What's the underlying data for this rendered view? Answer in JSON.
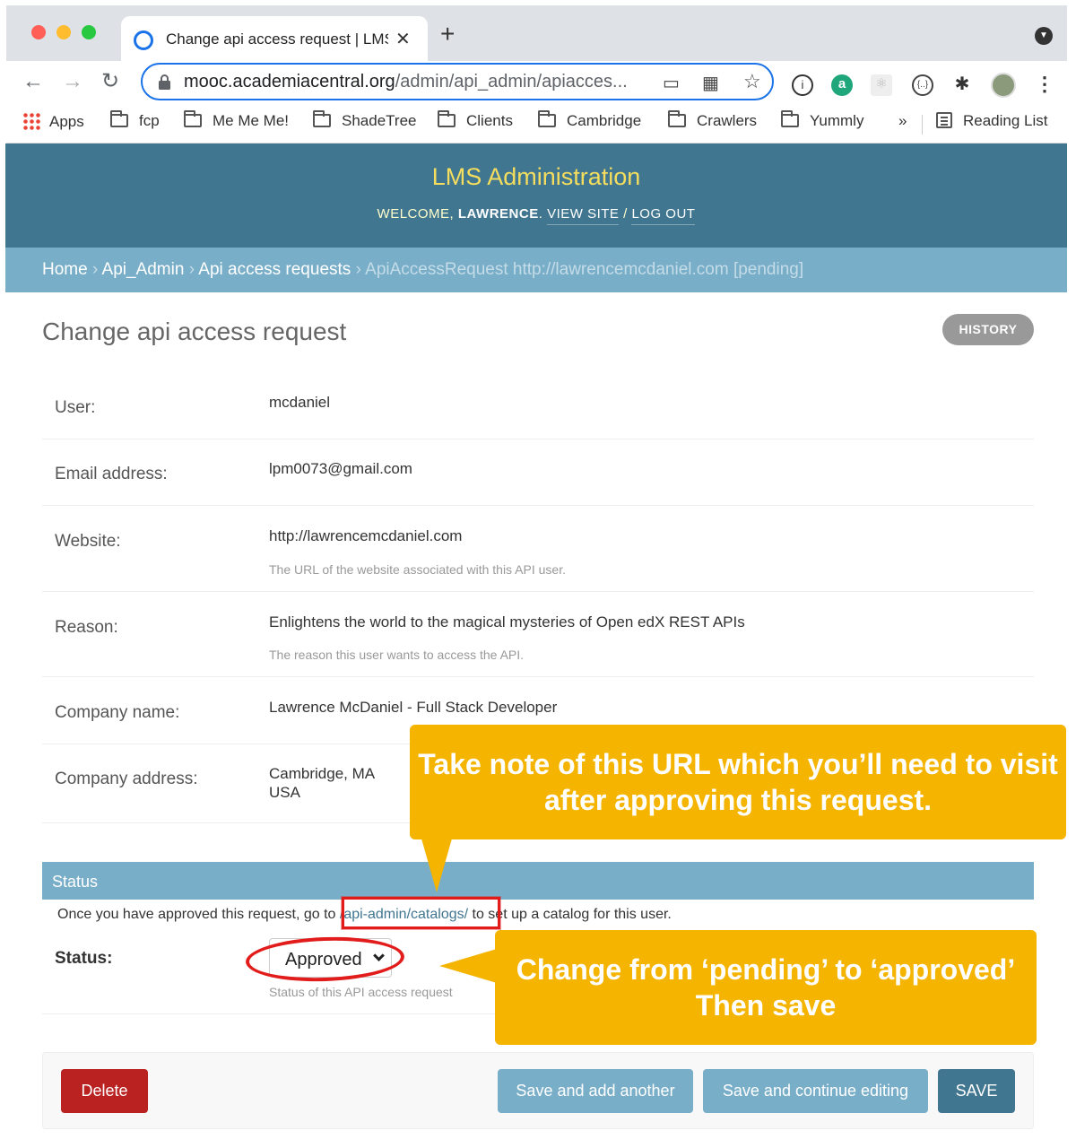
{
  "browser": {
    "tab_title": "Change api access request | LMS",
    "tab_close": "✕",
    "new_tab": "+",
    "nav": {
      "back": "←",
      "forward": "→",
      "reload": "↻"
    },
    "url_host": "mooc.academiacentral.org",
    "url_path": "/admin/api_admin/apiacces...",
    "omnibox_icons": {
      "cast": "▭",
      "qr": "▦",
      "star": "☆"
    },
    "extensions": {
      "one": "①",
      "a": "a",
      "brackets": "{..}",
      "puzzle": "✱",
      "menu": "⋮"
    },
    "bookmarks": {
      "apps": "Apps",
      "items": [
        "fcp",
        "Me Me Me!",
        "ShadeTree",
        "Clients",
        "Cambridge",
        "Crawlers",
        "Yummly"
      ],
      "overflow": "»",
      "reading_list": "Reading List"
    }
  },
  "header": {
    "branding": "LMS Administration",
    "welcome": "WELCOME,",
    "username": "LAWRENCE",
    "view_site": "VIEW SITE",
    "separator": "/",
    "log_out": "LOG OUT"
  },
  "breadcrumbs": {
    "home": "Home",
    "app": "Api_Admin",
    "model": "Api access requests",
    "current": "ApiAccessRequest http://lawrencemcdaniel.com [pending]",
    "sep": "›"
  },
  "page": {
    "title": "Change api access request",
    "history_button": "HISTORY"
  },
  "fields": [
    {
      "label": "User:",
      "value": "mcdaniel"
    },
    {
      "label": "Email address:",
      "value": "lpm0073@gmail.com"
    },
    {
      "label": "Website:",
      "value": "http://lawrencemcdaniel.com",
      "help": "The URL of the website associated with this API user."
    },
    {
      "label": "Reason:",
      "value": "Enlightens the world to the magical mysteries of Open edX REST APIs",
      "help": "The reason this user wants to access the API."
    },
    {
      "label": "Company name:",
      "value": "Lawrence McDaniel - Full Stack Developer"
    },
    {
      "label": "Company address:",
      "value_line1": "Cambridge, MA",
      "value_line2": "USA"
    }
  ],
  "status_section": {
    "heading": "Status",
    "desc_before": "Once you have approved this request, go to",
    "desc_link": "/api-admin/catalogs/",
    "desc_after": "to set up a catalog for this user.",
    "label": "Status:",
    "selected": "Approved",
    "help": "Status of this API access request"
  },
  "actions": {
    "delete": "Delete",
    "save_add": "Save and add another",
    "save_continue": "Save and continue editing",
    "save": "SAVE"
  },
  "annotations": {
    "callout1_line1": "Take note of this URL which you’ll need to visit",
    "callout1_line2": "after approving this request.",
    "callout2_line1": "Change from ‘pending’ to ‘approved’",
    "callout2_line2": "Then save"
  },
  "colors": {
    "header_bg": "#417690",
    "breadcrumbs_bg": "#79aec8",
    "branding": "#f5dd5d",
    "delete": "#ba2121",
    "save": "#417690",
    "secondary_button": "#79aec8",
    "callout": "#f4b400",
    "highlight": "#e21b1b"
  }
}
